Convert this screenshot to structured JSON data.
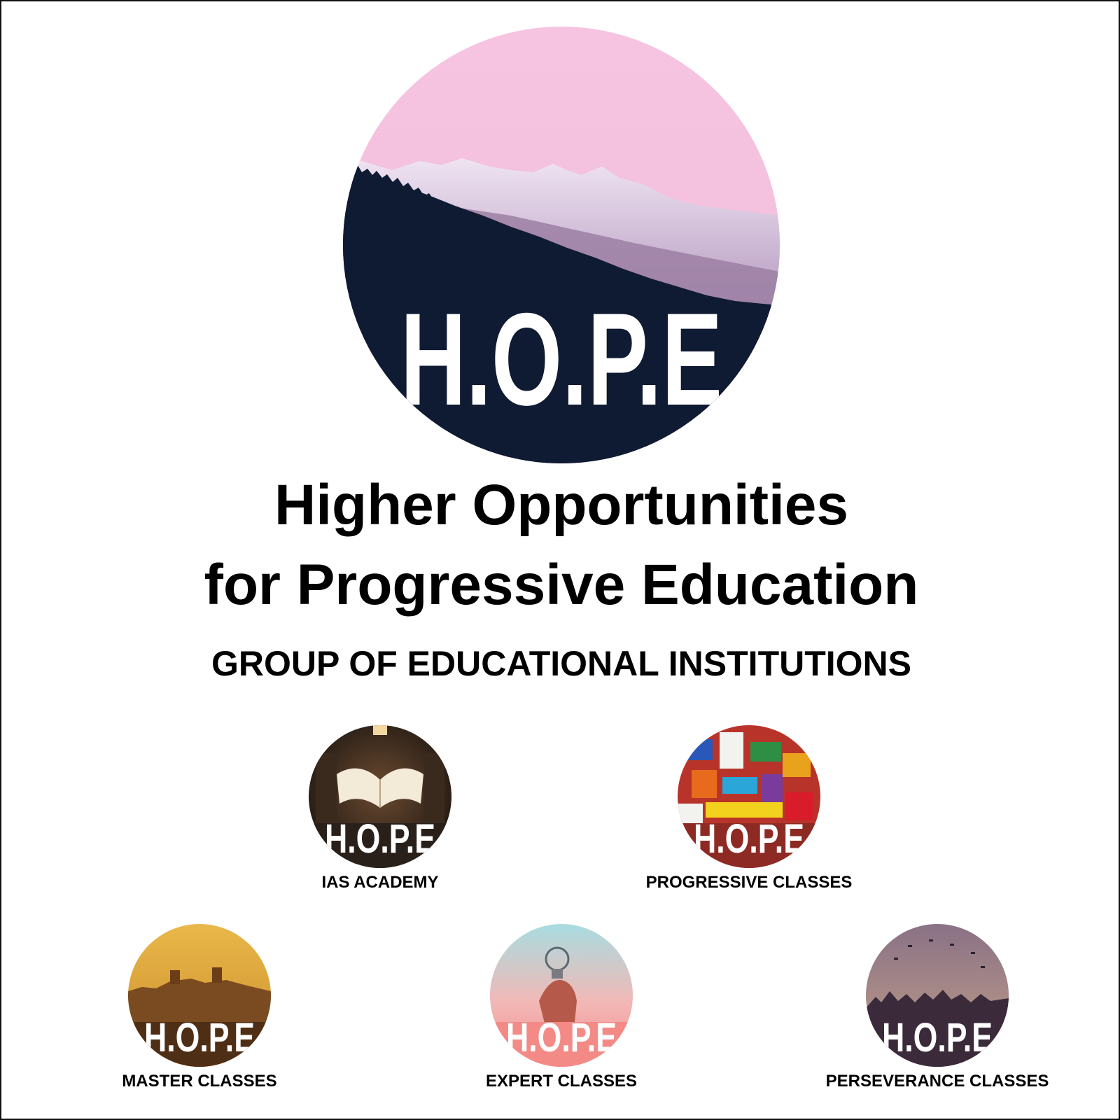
{
  "brand": {
    "logo_wordmark": "H.O.P.E",
    "headline_line1": "Higher Opportunities",
    "headline_line2": "for Progressive Education",
    "tagline": "GROUP OF EDUCATIONAL INSTITUTIONS"
  },
  "institutions": [
    {
      "name": "IAS ACADEMY",
      "wordmark": "H.O.P.E",
      "image_subject": "open book in library"
    },
    {
      "name": "PROGRESSIVE CLASSES",
      "wordmark": "H.O.P.E",
      "image_subject": "colourful toy bricks"
    },
    {
      "name": "MASTER CLASSES",
      "wordmark": "H.O.P.E",
      "image_subject": "fort at sunset"
    },
    {
      "name": "EXPERT CLASSES",
      "wordmark": "H.O.P.E",
      "image_subject": "hand holding light bulb"
    },
    {
      "name": "PERSEVERANCE CLASSES",
      "wordmark": "H.O.P.E",
      "image_subject": "graduates throwing caps"
    }
  ],
  "colors": {
    "sky_pink": "#f4c1de",
    "forest_navy": "#0f1b33",
    "text": "#000000",
    "background": "#ffffff"
  }
}
